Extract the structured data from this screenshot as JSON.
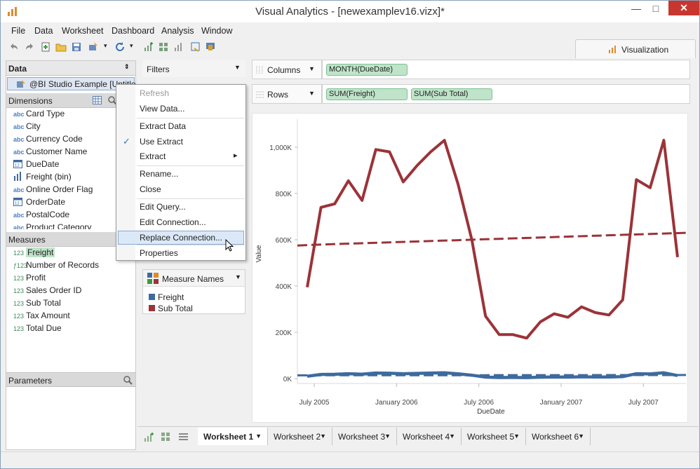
{
  "window": {
    "title": "Visual Analytics - [newexamplev16.vizx]*"
  },
  "menu": [
    "File",
    "Data",
    "Worksheet",
    "Dashboard",
    "Analysis",
    "Window"
  ],
  "visualization_tab": "Visualization",
  "data_panel": {
    "header": "Data",
    "connection": "@BI Studio Example [Untitle",
    "dimensions_label": "Dimensions",
    "dimensions": [
      {
        "icon": "abc",
        "name": "Card Type"
      },
      {
        "icon": "abc",
        "name": "City"
      },
      {
        "icon": "abc",
        "name": "Currency Code"
      },
      {
        "icon": "abc",
        "name": "Customer Name"
      },
      {
        "icon": "date",
        "name": "DueDate"
      },
      {
        "icon": "bin",
        "name": "Freight (bin)"
      },
      {
        "icon": "abc",
        "name": "Online Order Flag"
      },
      {
        "icon": "date",
        "name": "OrderDate"
      },
      {
        "icon": "abc",
        "name": "PostalCode"
      },
      {
        "icon": "abc",
        "name": "Product Category"
      }
    ],
    "measures_label": "Measures",
    "measures": [
      {
        "icon": "123",
        "name": "Freight"
      },
      {
        "icon": "calc123",
        "name": "Number of Records"
      },
      {
        "icon": "123",
        "name": "Profit"
      },
      {
        "icon": "123",
        "name": "Sales Order ID"
      },
      {
        "icon": "123",
        "name": "Sub Total"
      },
      {
        "icon": "123",
        "name": "Tax Amount"
      },
      {
        "icon": "123",
        "name": "Total Due"
      }
    ],
    "parameters_label": "Parameters"
  },
  "filters": {
    "label": "Filters"
  },
  "legend": {
    "title": "Measure Names",
    "items": [
      {
        "label": "Freight",
        "color": "#3e6a9e"
      },
      {
        "label": "Sub Total",
        "color": "#9b3338"
      }
    ]
  },
  "shelves": {
    "columns_label": "Columns",
    "columns_pills": [
      "MONTH(DueDate)"
    ],
    "rows_label": "Rows",
    "rows_pills": [
      "SUM(Freight)",
      "SUM(Sub Total)"
    ]
  },
  "context_menu": {
    "items": [
      {
        "label": "Refresh",
        "disabled": true
      },
      {
        "label": "View Data..."
      },
      {
        "label": "Extract Data"
      },
      {
        "label": "Use Extract",
        "checked": true
      },
      {
        "label": "Extract",
        "submenu": true
      },
      {
        "label": "Rename..."
      },
      {
        "label": "Close"
      },
      {
        "label": "Edit Query..."
      },
      {
        "label": "Edit Connection..."
      },
      {
        "label": "Replace Connection...",
        "highlighted": true
      },
      {
        "label": "Properties"
      }
    ]
  },
  "chart_data": {
    "type": "line",
    "xlabel": "DueDate",
    "ylabel": "Value",
    "y_ticks": [
      "0K",
      "200K",
      "400K",
      "600K",
      "800K",
      "1,000K"
    ],
    "x_ticks": [
      "July 2005",
      "January 2006",
      "July 2006",
      "January 2007",
      "July 2007"
    ],
    "ylim": [
      0,
      1100000
    ],
    "x": [
      "2005-07",
      "2005-08",
      "2005-09",
      "2005-10",
      "2005-11",
      "2005-12",
      "2006-01",
      "2006-02",
      "2006-03",
      "2006-04",
      "2006-05",
      "2006-06",
      "2006-07",
      "2006-08",
      "2006-09",
      "2006-10",
      "2006-11",
      "2006-12",
      "2007-01",
      "2007-02",
      "2007-03",
      "2007-04",
      "2007-05",
      "2007-06",
      "2007-07",
      "2007-08",
      "2007-09",
      "2007-10"
    ],
    "series": [
      {
        "name": "Sub Total",
        "color": "#9b3338",
        "values": [
          395000,
          740000,
          755000,
          855000,
          770000,
          990000,
          980000,
          850000,
          920000,
          980000,
          1030000,
          840000,
          600000,
          270000,
          190000,
          190000,
          175000,
          245000,
          280000,
          265000,
          310000,
          285000,
          275000,
          340000,
          860000,
          825000,
          1030000,
          525000
        ]
      },
      {
        "name": "Sub Total trend",
        "color": "#9b3338",
        "values": [
          575000,
          578000,
          580000,
          582000,
          584000,
          586000,
          588000,
          590000,
          592000,
          594000,
          596000,
          598000,
          600000,
          602000,
          604000,
          606000,
          608000,
          610000,
          612000,
          614000,
          616000,
          618000,
          620000,
          622000,
          624000,
          626000,
          628000,
          630000
        ]
      },
      {
        "name": "Freight",
        "color": "#3e6a9e",
        "values": [
          10000,
          18000,
          18500,
          21000,
          19000,
          24000,
          23000,
          21000,
          22500,
          24000,
          25000,
          20500,
          14500,
          6500,
          4600,
          4700,
          4300,
          6000,
          6900,
          6500,
          7600,
          7000,
          6800,
          8400,
          21000,
          20000,
          25000,
          13000
        ]
      },
      {
        "name": "Freight trend",
        "color": "#3e6a9e",
        "values": [
          14000,
          14050,
          14100,
          14150,
          14200,
          14250,
          14300,
          14350,
          14400,
          14450,
          14500,
          14550,
          14600,
          14650,
          14700,
          14750,
          14800,
          14850,
          14900,
          14950,
          15000,
          15050,
          15100,
          15150,
          15200,
          15250,
          15300,
          15350
        ]
      }
    ],
    "grid": false,
    "legend": "left"
  },
  "worksheet_tabs": [
    "Worksheet 1",
    "Worksheet 2",
    "Worksheet 3",
    "Worksheet 4",
    "Worksheet 5",
    "Worksheet 6"
  ],
  "active_worksheet": "Worksheet 1",
  "icons": {
    "app": "chart-app-icon",
    "check": "✓",
    "submenu": "▸",
    "dropdown": "▾"
  }
}
